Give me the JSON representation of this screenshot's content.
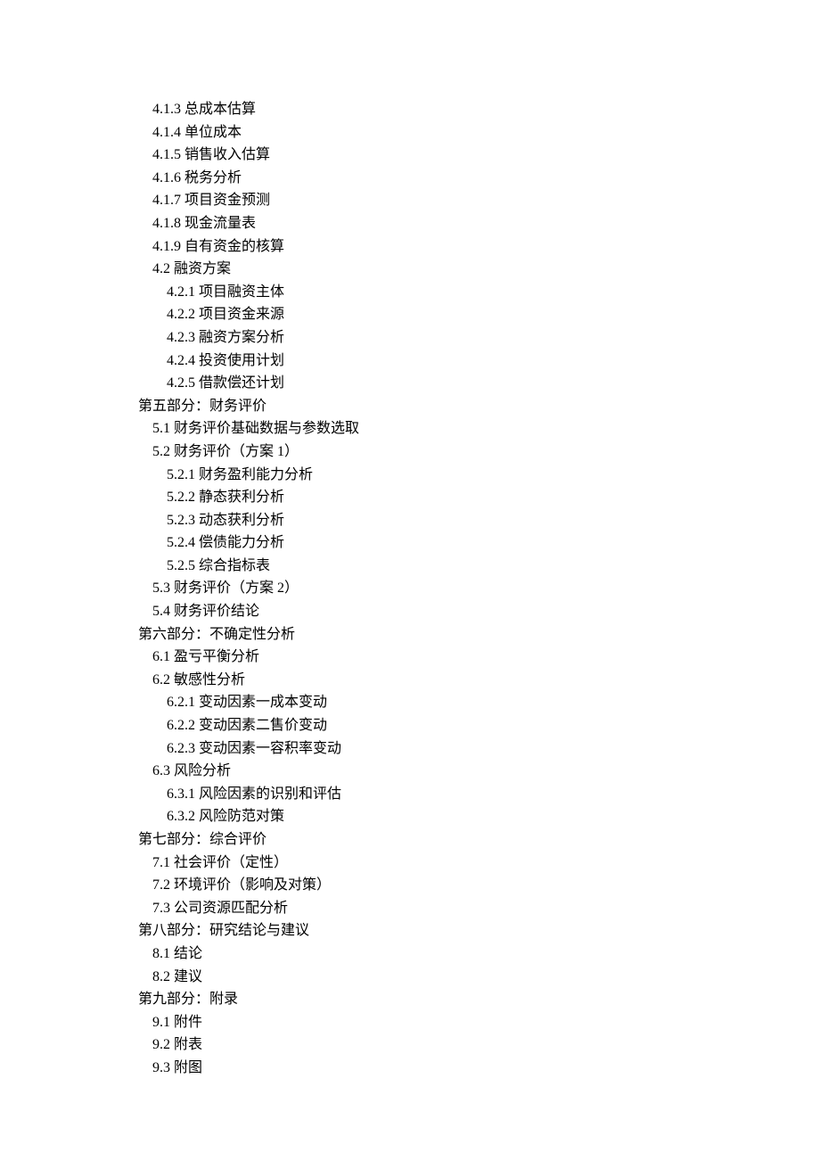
{
  "toc": [
    {
      "level": 1,
      "text": "4.1.3 总成本估算"
    },
    {
      "level": 1,
      "text": "4.1.4 单位成本"
    },
    {
      "level": 1,
      "text": "4.1.5 销售收入估算"
    },
    {
      "level": 1,
      "text": "4.1.6 税务分析"
    },
    {
      "level": 1,
      "text": "4.1.7 项目资金预测"
    },
    {
      "level": 1,
      "text": "4.1.8 现金流量表"
    },
    {
      "level": 1,
      "text": "4.1.9 自有资金的核算"
    },
    {
      "level": 1,
      "text": "4.2 融资方案"
    },
    {
      "level": 2,
      "text": "4.2.1 项目融资主体"
    },
    {
      "level": 2,
      "text": "4.2.2 项目资金来源"
    },
    {
      "level": 2,
      "text": "4.2.3 融资方案分析"
    },
    {
      "level": 2,
      "text": "4.2.4 投资使用计划"
    },
    {
      "level": 2,
      "text": "4.2.5 借款偿还计划"
    },
    {
      "level": 0,
      "text": "第五部分：财务评价"
    },
    {
      "level": 1,
      "text": "5.1 财务评价基础数据与参数选取"
    },
    {
      "level": 1,
      "text": "5.2 财务评价（方案 1）"
    },
    {
      "level": 2,
      "text": "5.2.1 财务盈利能力分析"
    },
    {
      "level": 2,
      "text": "5.2.2 静态获利分析"
    },
    {
      "level": 2,
      "text": "5.2.3 动态获利分析"
    },
    {
      "level": 2,
      "text": "5.2.4 偿债能力分析"
    },
    {
      "level": 2,
      "text": "5.2.5 综合指标表"
    },
    {
      "level": 1,
      "text": "5.3 财务评价（方案 2）"
    },
    {
      "level": 1,
      "text": "5.4 财务评价结论"
    },
    {
      "level": 0,
      "text": "第六部分：不确定性分析"
    },
    {
      "level": 1,
      "text": "6.1 盈亏平衡分析"
    },
    {
      "level": 1,
      "text": "6.2 敏感性分析"
    },
    {
      "level": 2,
      "text": "6.2.1 变动因素一成本变动"
    },
    {
      "level": 2,
      "text": "6.2.2 变动因素二售价变动"
    },
    {
      "level": 2,
      "text": "6.2.3 变动因素一容积率变动"
    },
    {
      "level": 1,
      "text": "6.3 风险分析"
    },
    {
      "level": 2,
      "text": "6.3.1 风险因素的识别和评估"
    },
    {
      "level": 2,
      "text": "6.3.2 风险防范对策"
    },
    {
      "level": 0,
      "text": "第七部分：综合评价"
    },
    {
      "level": 1,
      "text": "7.1 社会评价（定性）"
    },
    {
      "level": 1,
      "text": "7.2 环境评价（影响及对策）"
    },
    {
      "level": 1,
      "text": "7.3 公司资源匹配分析"
    },
    {
      "level": 0,
      "text": "第八部分：研究结论与建议"
    },
    {
      "level": 1,
      "text": "8.1 结论"
    },
    {
      "level": 1,
      "text": "8.2 建议"
    },
    {
      "level": 0,
      "text": "第九部分：附录"
    },
    {
      "level": 1,
      "text": "9.1 附件"
    },
    {
      "level": 1,
      "text": "9.2 附表"
    },
    {
      "level": 1,
      "text": "9.3 附图"
    }
  ]
}
